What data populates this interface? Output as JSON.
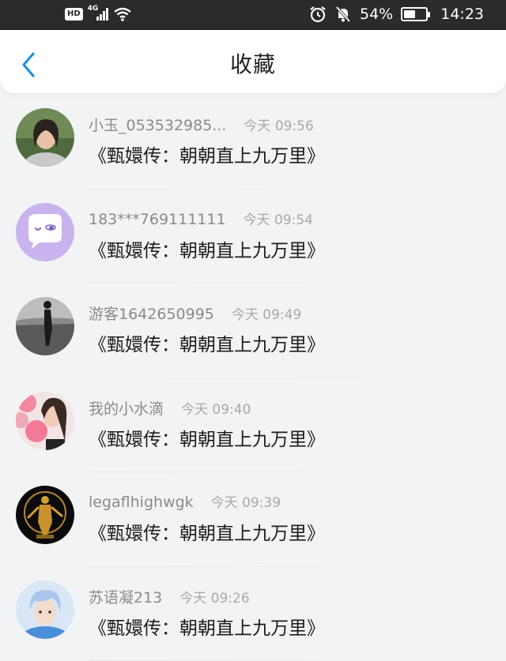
{
  "status_bar": {
    "network": "4G",
    "hd": "HD",
    "battery_percent": "54%",
    "battery_level": 0.54,
    "time": "14:23"
  },
  "header": {
    "title": "收藏"
  },
  "favorites": [
    {
      "name": "小玉_053532985...",
      "time": "今天 09:56",
      "title": "《甄嬛传：朝朝直上九万里》",
      "avatar": "photo-woman-avatar"
    },
    {
      "name": "183***769111111",
      "time": "今天 09:54",
      "title": "《甄嬛传：朝朝直上九万里》",
      "avatar": "purple-chat-bubble-avatar"
    },
    {
      "name": "游客1642650995",
      "time": "今天 09:49",
      "title": "《甄嬛传：朝朝直上九万里》",
      "avatar": "grayscale-person-avatar"
    },
    {
      "name": "我的小水滴",
      "time": "今天 09:40",
      "title": "《甄嬛传：朝朝直上九万里》",
      "avatar": "pink-balloons-avatar"
    },
    {
      "name": "legaflhighwgk",
      "time": "今天 09:39",
      "title": "《甄嬛传：朝朝直上九万里》",
      "avatar": "golden-statue-avatar"
    },
    {
      "name": "苏语凝213",
      "time": "今天 09:26",
      "title": "《甄嬛传：朝朝直上九万里》",
      "avatar": "blue-hair-avatar"
    }
  ],
  "colors": {
    "back_arrow": "#1e90e6",
    "statusbar_bg": "#2b2b2b",
    "page_bg": "#f2f3f5"
  }
}
